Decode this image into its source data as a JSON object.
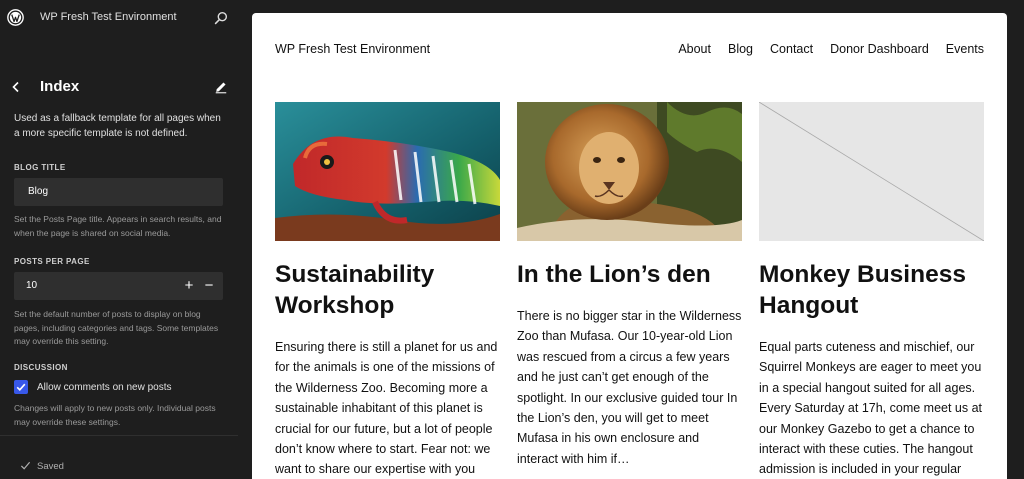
{
  "topbar": {
    "site_name": "WP Fresh Test Environment"
  },
  "sidebar": {
    "title": "Index",
    "description": "Used as a fallback template for all pages when a more specific template is not defined.",
    "blog_title": {
      "label": "BLOG TITLE",
      "value": "Blog",
      "help": "Set the Posts Page title. Appears in search results, and when the page is shared on social media."
    },
    "posts_per_page": {
      "label": "POSTS PER PAGE",
      "value": "10",
      "increment": "+",
      "decrement": "−",
      "help": "Set the default number of posts to display on blog pages, including categories and tags. Some templates may override this setting."
    },
    "discussion": {
      "label": "DISCUSSION",
      "checkbox_label": "Allow comments on new posts",
      "checked": true,
      "help": "Changes will apply to new posts only. Individual posts may override these settings."
    },
    "saved_label": "Saved"
  },
  "canvas": {
    "site_title": "WP Fresh Test Environment",
    "nav": [
      "About",
      "Blog",
      "Contact",
      "Donor Dashboard",
      "Events"
    ],
    "posts": [
      {
        "image": "chameleon-photo",
        "title": "Sustainability Workshop",
        "excerpt": "Ensuring there is still a planet for us and for the animals is one of the missions of the Wilderness Zoo. Becoming more a sustainable inhabitant of this planet is crucial for our future, but a lot of people don’t know where to start. Fear not: we want to share our expertise with you"
      },
      {
        "image": "lion-photo",
        "title": "In the Lion’s den",
        "excerpt": "There is no bigger star in the Wilderness Zoo than Mufasa. Our 10-year-old Lion was rescued from a circus a few years and he just can’t get enough of the spotlight. In our exclusive guided tour In the Lion’s den, you will get to meet Mufasa in his own enclosure and interact with him if…"
      },
      {
        "image": "placeholder-image",
        "title": "Monkey Business Hangout",
        "excerpt": "Equal parts cuteness and mischief, our Squirrel Monkeys are eager to meet you in a special hangout suited for all ages. Every Saturday at 17h, come meet us at our Monkey Gazebo to get a chance to interact with these cuties. The hangout admission is included in your regular"
      }
    ]
  },
  "colors": {
    "sidebar_bg": "#1e1e1e",
    "accent": "#3858e9",
    "input_bg": "#2f2f2f",
    "canvas_bg": "#ffffff"
  }
}
